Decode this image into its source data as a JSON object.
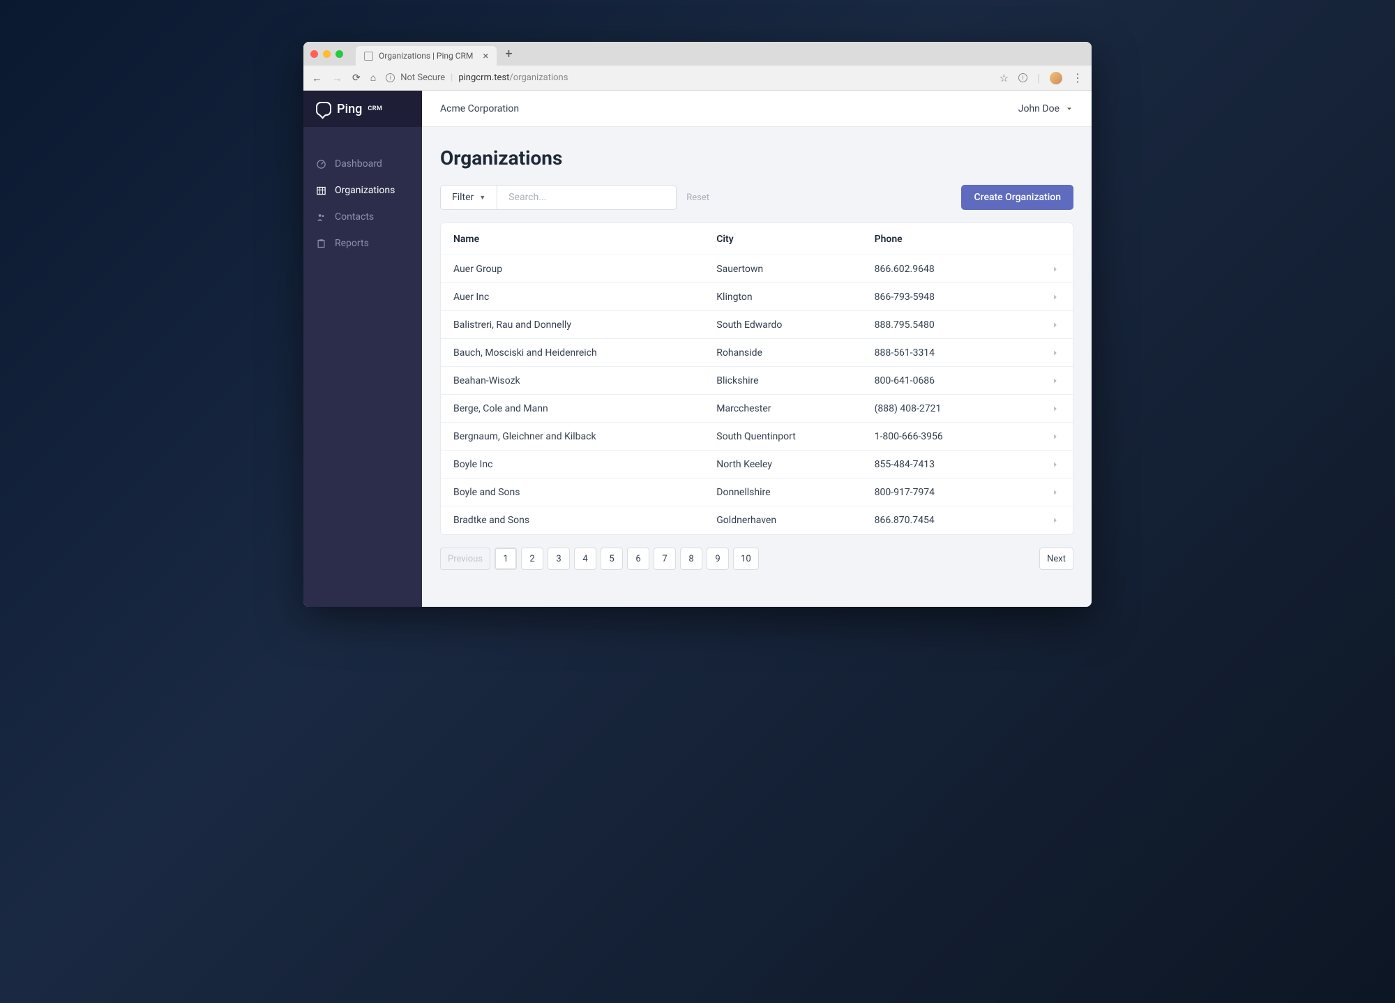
{
  "browser": {
    "tab_title": "Organizations | Ping CRM",
    "security_label": "Not Secure",
    "url_domain": "pingcrm.test",
    "url_path": "/organizations"
  },
  "logo": {
    "main": "Ping",
    "sub": "CRM"
  },
  "sidebar": {
    "items": [
      {
        "label": "Dashboard",
        "icon": "dashboard"
      },
      {
        "label": "Organizations",
        "icon": "organizations"
      },
      {
        "label": "Contacts",
        "icon": "contacts"
      },
      {
        "label": "Reports",
        "icon": "reports"
      }
    ]
  },
  "topbar": {
    "org": "Acme Corporation",
    "user": "John Doe"
  },
  "page": {
    "title": "Organizations",
    "filter_label": "Filter",
    "search_placeholder": "Search...",
    "reset_label": "Reset",
    "create_label": "Create Organization"
  },
  "table": {
    "headers": {
      "name": "Name",
      "city": "City",
      "phone": "Phone"
    },
    "rows": [
      {
        "name": "Auer Group",
        "city": "Sauertown",
        "phone": "866.602.9648"
      },
      {
        "name": "Auer Inc",
        "city": "Klington",
        "phone": "866-793-5948"
      },
      {
        "name": "Balistreri, Rau and Donnelly",
        "city": "South Edwardo",
        "phone": "888.795.5480"
      },
      {
        "name": "Bauch, Mosciski and Heidenreich",
        "city": "Rohanside",
        "phone": "888-561-3314"
      },
      {
        "name": "Beahan-Wisozk",
        "city": "Blickshire",
        "phone": "800-641-0686"
      },
      {
        "name": "Berge, Cole and Mann",
        "city": "Marcchester",
        "phone": "(888) 408-2721"
      },
      {
        "name": "Bergnaum, Gleichner and Kilback",
        "city": "South Quentinport",
        "phone": "1-800-666-3956"
      },
      {
        "name": "Boyle Inc",
        "city": "North Keeley",
        "phone": "855-484-7413"
      },
      {
        "name": "Boyle and Sons",
        "city": "Donnellshire",
        "phone": "800-917-7974"
      },
      {
        "name": "Bradtke and Sons",
        "city": "Goldnerhaven",
        "phone": "866.870.7454"
      }
    ]
  },
  "pagination": {
    "previous": "Previous",
    "next": "Next",
    "pages": [
      "1",
      "2",
      "3",
      "4",
      "5",
      "6",
      "7",
      "8",
      "9",
      "10"
    ],
    "current": "1"
  }
}
